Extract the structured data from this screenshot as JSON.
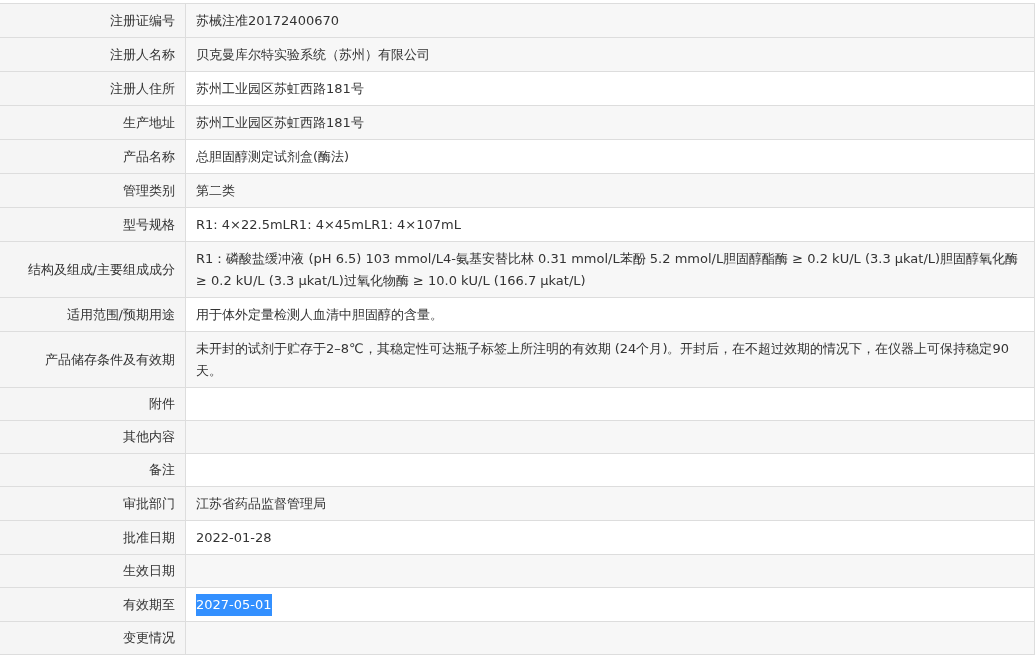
{
  "rows": [
    {
      "label": "注册证编号",
      "value": "苏械注准20172400670",
      "hovered": true
    },
    {
      "label": "注册人名称",
      "value": "贝克曼库尔特实验系统（苏州）有限公司"
    },
    {
      "label": "注册人住所",
      "value": "苏州工业园区苏虹西路181号"
    },
    {
      "label": "生产地址",
      "value": "苏州工业园区苏虹西路181号"
    },
    {
      "label": "产品名称",
      "value": "总胆固醇测定试剂盒(酶法)"
    },
    {
      "label": "管理类别",
      "value": "第二类"
    },
    {
      "label": "型号规格",
      "value": "R1: 4×22.5mLR1: 4×45mLR1: 4×107mL"
    },
    {
      "label": "结构及组成/主要组成成分",
      "value": "R1：磷酸盐缓冲液 (pH 6.5) 103 mmol/L4-氨基安替比林 0.31 mmol/L苯酚 5.2 mmol/L胆固醇酯酶 ≥ 0.2 kU/L (3.3 µkat/L)胆固醇氧化酶 ≥ 0.2 kU/L (3.3 µkat/L)过氧化物酶 ≥ 10.0 kU/L (166.7 µkat/L)"
    },
    {
      "label": "适用范围/预期用途",
      "value": "用于体外定量检测人血清中胆固醇的含量。"
    },
    {
      "label": "产品储存条件及有效期",
      "value": "未开封的试剂于贮存于2–8℃，其稳定性可达瓶子标签上所注明的有效期 (24个月)。开封后，在不超过效期的情况下，在仪器上可保持稳定90天。"
    },
    {
      "label": "附件"
    },
    {
      "label": "其他内容"
    },
    {
      "label": "备注"
    },
    {
      "label": "审批部门",
      "value": "江苏省药品监督管理局"
    },
    {
      "label": "批准日期",
      "value": "2022-01-28"
    },
    {
      "label": "生效日期"
    },
    {
      "label": "有效期至",
      "value": "2027-05-01",
      "text_selected": true
    },
    {
      "label": "变更情况"
    }
  ]
}
